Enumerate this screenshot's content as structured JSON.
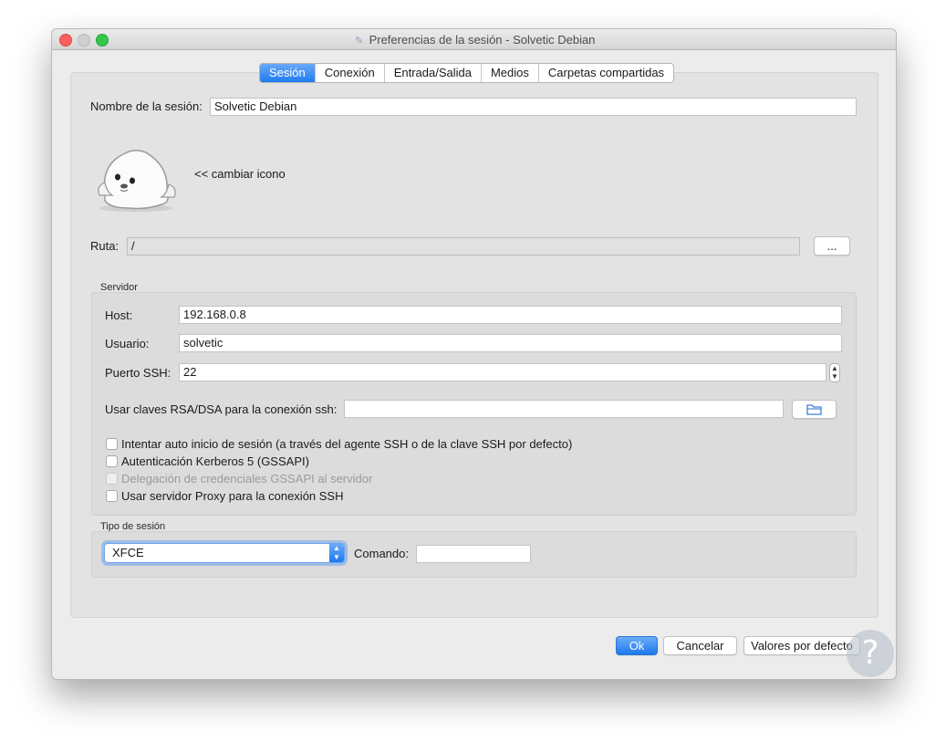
{
  "window": {
    "title": "Preferencias de la sesión - Solvetic Debian"
  },
  "tabs": [
    "Sesión",
    "Conexión",
    "Entrada/Salida",
    "Medios",
    "Carpetas compartidas"
  ],
  "session": {
    "name_label": "Nombre de la sesión:",
    "name_value": "Solvetic Debian",
    "change_icon": "<< cambiar icono"
  },
  "path": {
    "label": "Ruta:",
    "value": "/",
    "browse": "..."
  },
  "server": {
    "group_title": "Servidor",
    "host_label": "Host:",
    "host_value": "192.168.0.8",
    "user_label": "Usuario:",
    "user_value": "solvetic",
    "port_label": "Puerto SSH:",
    "port_value": "22",
    "keys_label": "Usar claves RSA/DSA para la conexión ssh:",
    "keys_value": "",
    "checkboxes": [
      {
        "label": "Intentar auto inicio de sesión (a través del agente SSH o de la clave SSH por defecto)",
        "checked": false,
        "enabled": true
      },
      {
        "label": "Autenticación Kerberos 5 (GSSAPI)",
        "checked": false,
        "enabled": true
      },
      {
        "label": "Delegación de credenciales GSSAPI al servidor",
        "checked": false,
        "enabled": false
      },
      {
        "label": "Usar servidor Proxy para la conexión SSH",
        "checked": false,
        "enabled": true
      }
    ]
  },
  "session_type": {
    "group_title": "Tipo de sesión",
    "selected": "XFCE",
    "command_label": "Comando:",
    "command_value": ""
  },
  "buttons": {
    "ok": "Ok",
    "cancel": "Cancelar",
    "defaults": "Valores por defecto"
  },
  "icons": {
    "title": "document-icon",
    "avatar": "seal-avatar-icon",
    "folder": "folder-icon",
    "help": "help-icon"
  },
  "colors": {
    "accent": "#1f7cf1",
    "window_bg": "#ececec"
  }
}
